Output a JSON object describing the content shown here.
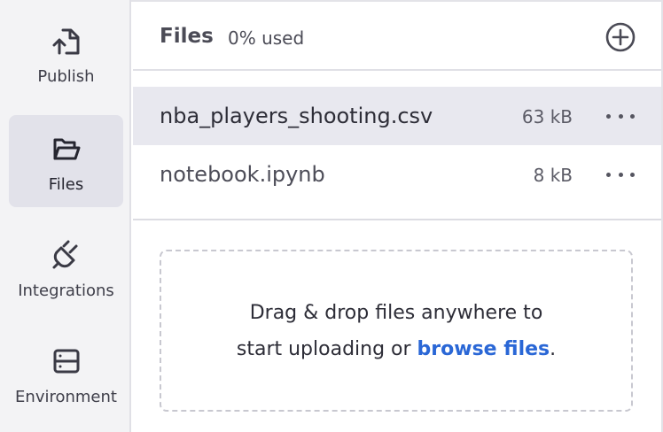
{
  "sidebar": {
    "items": [
      {
        "label": "Publish",
        "icon": "publish-icon",
        "active": false
      },
      {
        "label": "Files",
        "icon": "folder-icon",
        "active": true
      },
      {
        "label": "Integrations",
        "icon": "plug-icon",
        "active": false
      },
      {
        "label": "Environment",
        "icon": "server-icon",
        "active": false
      }
    ]
  },
  "header": {
    "title": "Files",
    "usage": "0% used",
    "add_icon": "plus-circle-icon"
  },
  "files": [
    {
      "name": "nba_players_shooting.csv",
      "size": "63 kB",
      "selected": true
    },
    {
      "name": "notebook.ipynb",
      "size": "8 kB",
      "selected": false
    }
  ],
  "dropzone": {
    "line1": "Drag & drop files anywhere to",
    "line2_prefix": "start uploading or ",
    "link_text": "browse files",
    "suffix": "."
  },
  "colors": {
    "link": "#2a67d6",
    "sidebar_bg": "#f3f3f5",
    "active_item_bg": "#e2e2ea",
    "selected_row_bg": "#e8e8ef"
  }
}
